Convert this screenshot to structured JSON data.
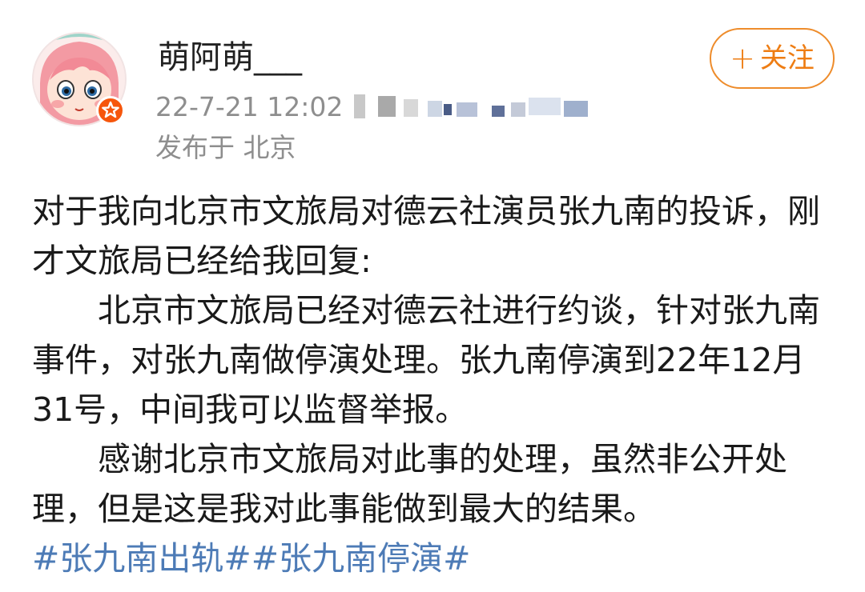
{
  "post": {
    "author": {
      "name": "萌阿萌___",
      "avatar": "cartoon-girl-avatar",
      "badge": "orange-verified-star-badge"
    },
    "timestamp": "22-7-21 12:02",
    "device_info_blurred": true,
    "location": "发布于 北京",
    "follow_button": {
      "plus": "+",
      "label": "关注"
    },
    "body": {
      "intro": "对于我向北京市文旅局对德云社演员张九南的投诉，刚才文旅局已经给我回复:",
      "reply": "北京市文旅局已经对德云社进行约谈，针对张九南事件，对张九南做停演处理。张九南停演到22年12月31号，中间我可以监督举报。",
      "thanks": "感谢北京市文旅局对此事的处理，虽然非公开处理，但是这是我对此事能做到最大的结果。"
    },
    "hashtags": [
      "#张九南出轨#",
      "#张九南停演#"
    ]
  },
  "colors": {
    "accent_orange": "#ee7d13",
    "hashtag_blue": "#4d7bb6",
    "meta_gray": "#8e8e8e",
    "badge_orange": "#f6560c"
  }
}
